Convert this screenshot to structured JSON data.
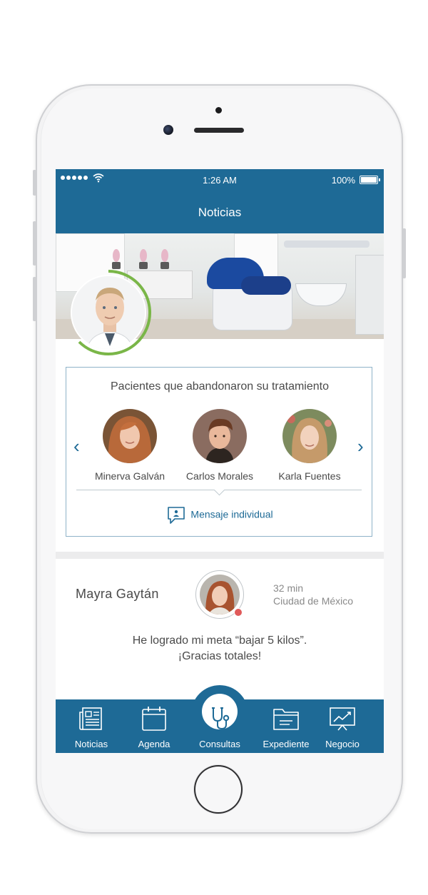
{
  "status_bar": {
    "time": "1:26 AM",
    "battery": "100%"
  },
  "nav": {
    "title": "Noticias"
  },
  "patients_card": {
    "heading": "Pacientes que abandonaron su tratamiento",
    "patients": [
      {
        "name": "Minerva Galván"
      },
      {
        "name": "Carlos Morales"
      },
      {
        "name": "Karla Fuentes"
      }
    ],
    "message_label": "Mensaje individual"
  },
  "post": {
    "author": "Mayra Gaytán",
    "time": "32 min",
    "location": "Ciudad de México",
    "text_line1": "He logrado mi meta “bajar 5 kilos”.",
    "text_line2": "¡Gracias totales!"
  },
  "tabs": [
    {
      "label": "Noticias",
      "icon": "newspaper-icon"
    },
    {
      "label": "Agenda",
      "icon": "calendar-icon"
    },
    {
      "label": "Consultas",
      "icon": "stethoscope-icon",
      "active": true
    },
    {
      "label": "Expediente",
      "icon": "folder-icon"
    },
    {
      "label": "Negocio",
      "icon": "chart-icon"
    }
  ],
  "colors": {
    "primary": "#1e6a96",
    "progress": "#7ab648",
    "online": "#e05a5a"
  }
}
